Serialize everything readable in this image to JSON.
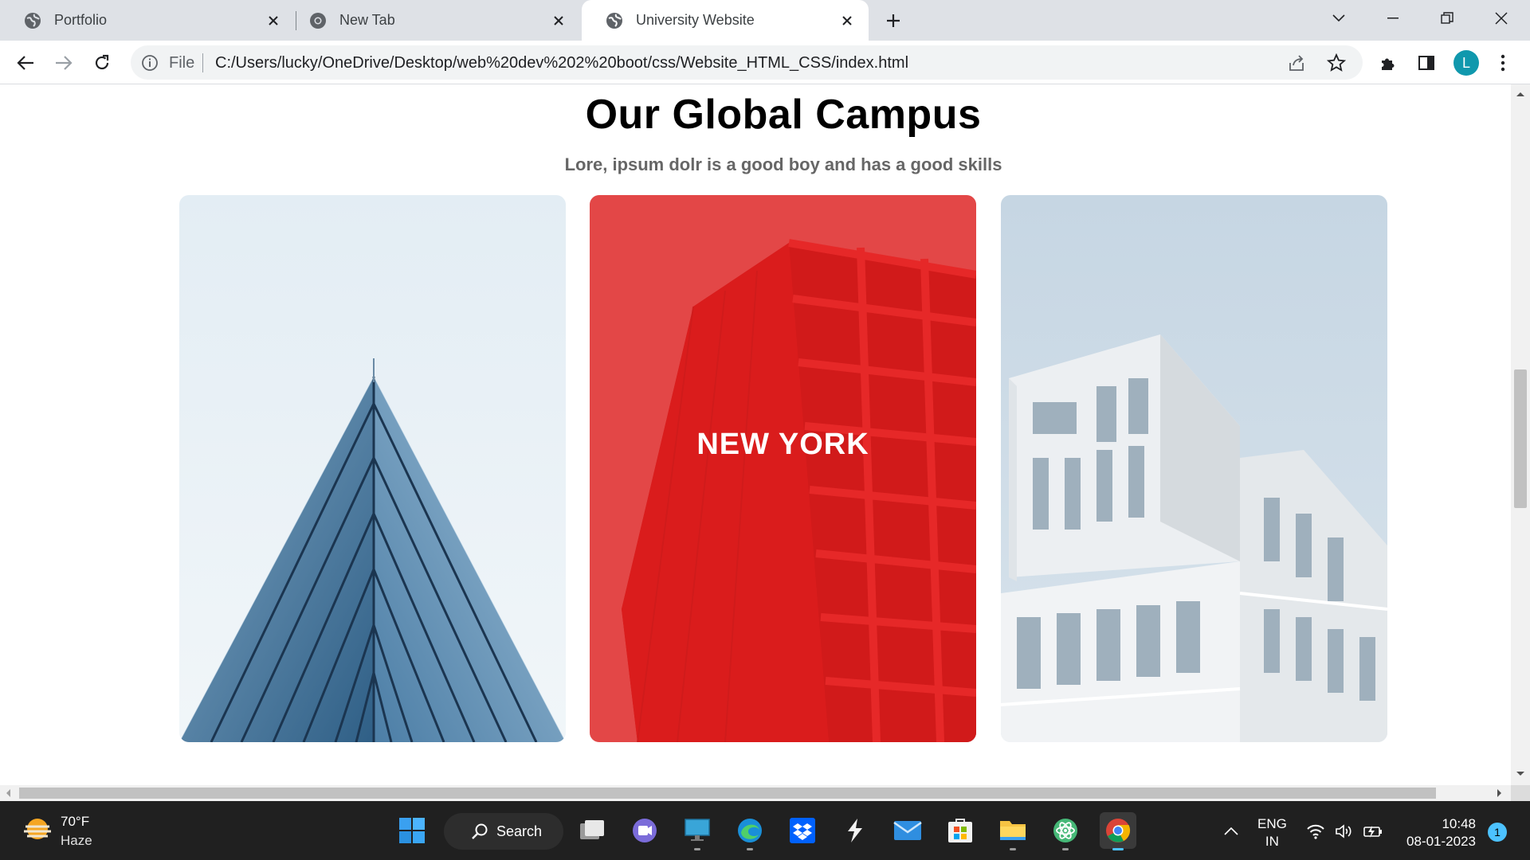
{
  "browser": {
    "tabs": [
      {
        "title": "Portfolio",
        "active": false
      },
      {
        "title": "New Tab",
        "active": false
      },
      {
        "title": "University Website",
        "active": true
      }
    ],
    "address": {
      "scheme": "File",
      "url": "C:/Users/lucky/OneDrive/Desktop/web%20dev%202%20boot/css/Website_HTML_CSS/index.html"
    },
    "profile_initial": "L"
  },
  "page": {
    "title": "Our Global Campus",
    "subtitle": "Lore, ipsum dolr is a good boy and has a good skills",
    "cards": [
      {
        "caption": "",
        "image": "glass-pyramid-building"
      },
      {
        "caption": "NEW YORK",
        "image": "red-glass-tower"
      },
      {
        "caption": "",
        "image": "white-modern-building"
      }
    ]
  },
  "taskbar": {
    "weather": {
      "temp": "70°F",
      "condition": "Haze"
    },
    "search_label": "Search",
    "language": {
      "line1": "ENG",
      "line2": "IN"
    },
    "clock": {
      "time": "10:48",
      "date": "08-01-2023"
    },
    "notification_count": "1"
  },
  "colors": {
    "accent": "#4cc2ff",
    "card_overlay": "#e61e1e",
    "taskbar": "#202020",
    "tabstrip": "#dee1e6"
  }
}
